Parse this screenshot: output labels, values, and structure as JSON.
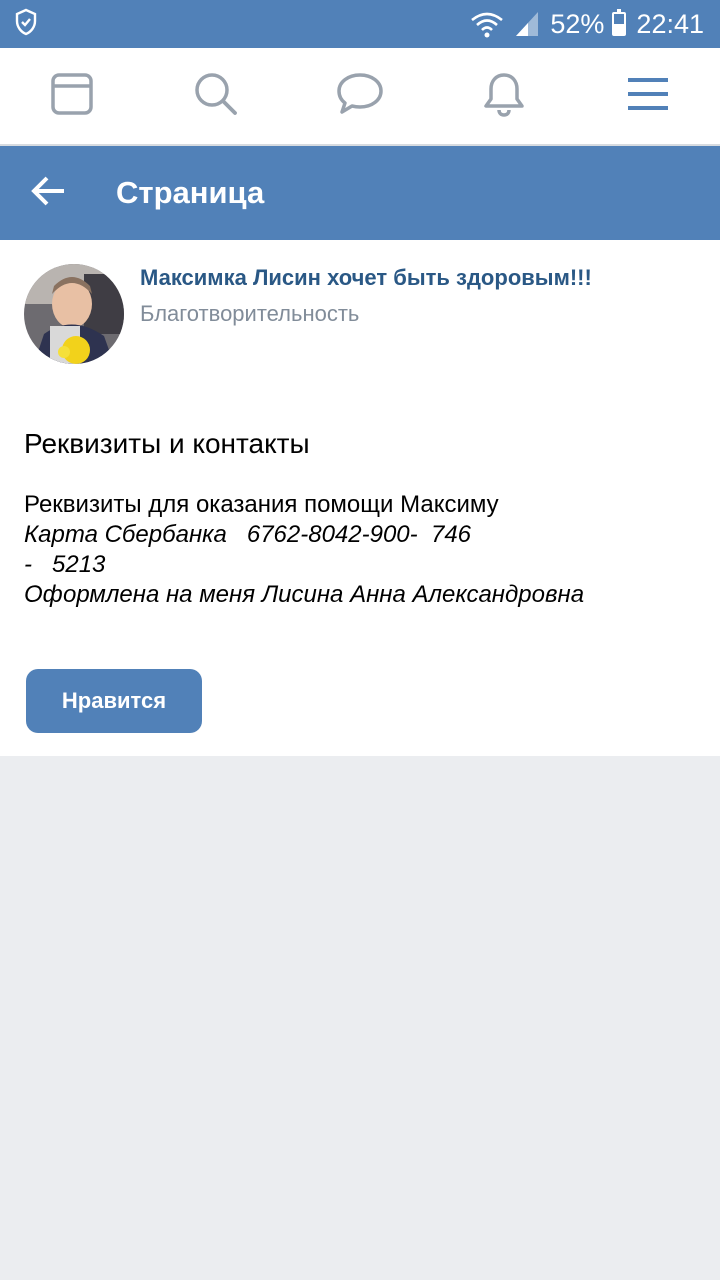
{
  "status_bar": {
    "battery_percent": "52%",
    "battery_level": 0.52,
    "time": "22:41",
    "icons": [
      "shield-icon",
      "wifi-icon",
      "signal-icon",
      "battery-icon"
    ]
  },
  "top_nav": {
    "items": [
      {
        "name": "news",
        "icon": "news-feed-icon"
      },
      {
        "name": "search",
        "icon": "search-icon"
      },
      {
        "name": "messages",
        "icon": "chat-bubble-icon"
      },
      {
        "name": "notifications",
        "icon": "bell-icon"
      },
      {
        "name": "menu",
        "icon": "hamburger-menu-icon"
      }
    ]
  },
  "header": {
    "title": "Страница",
    "back_icon": "arrow-left-icon"
  },
  "group": {
    "name": "Максимка Лисин хочет быть здоровым!!!",
    "category": "Благотворительность"
  },
  "section": {
    "title": "Реквизиты и контакты",
    "lines": [
      "Реквизиты для оказания помощи Максиму",
      "Карта Сбербанка   6762-8042-900-  746",
      "-   5213",
      "Оформлена на меня Лисина Анна Александровна"
    ]
  },
  "like_button": {
    "label": "Нравится"
  },
  "colors": {
    "brand_blue": "#5181b8",
    "link_blue": "#2a5885",
    "secondary_text": "#818c99",
    "page_bg": "#ebedf0",
    "nav_icon_gray": "#99a2ad"
  }
}
